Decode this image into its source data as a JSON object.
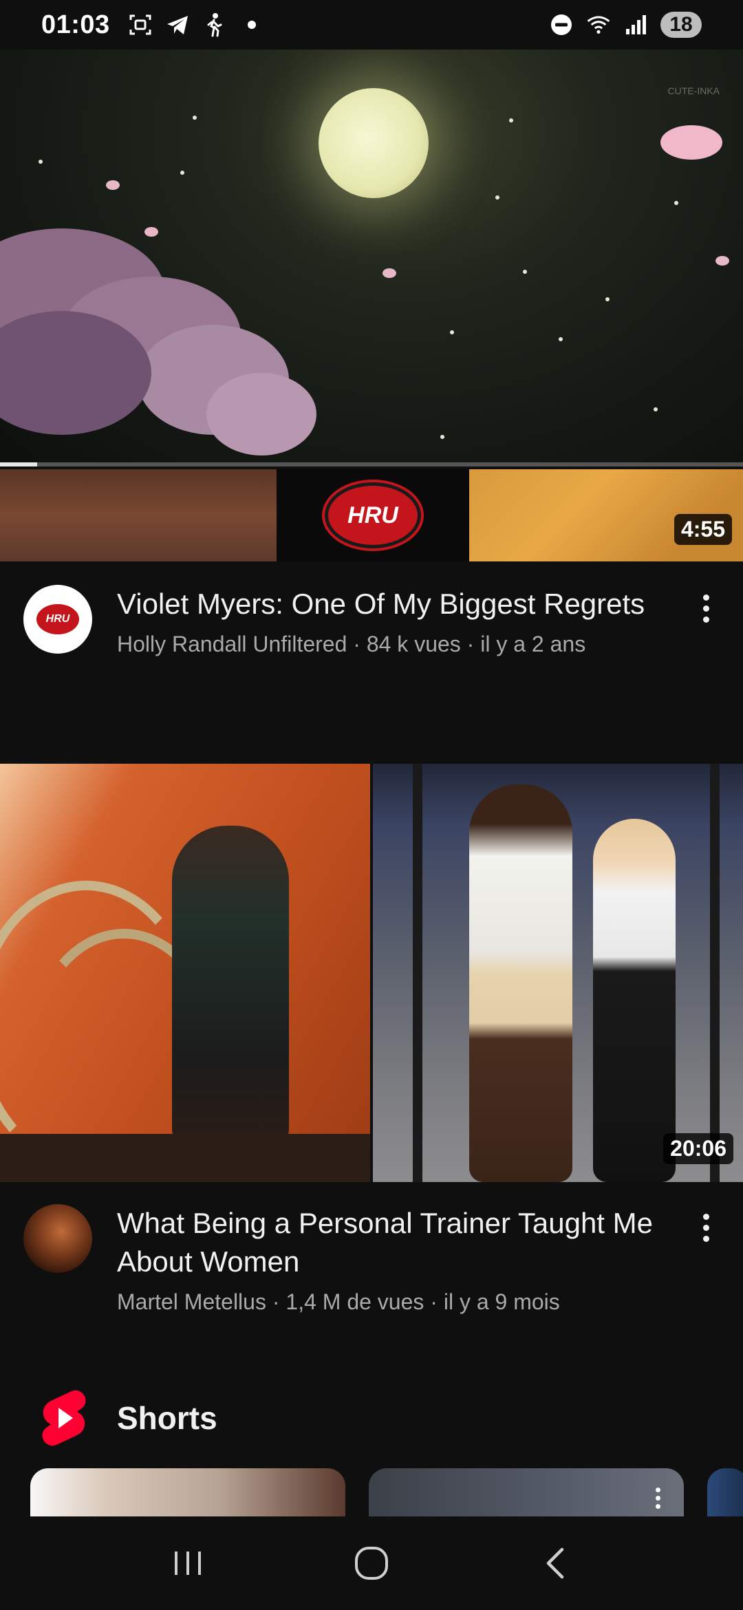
{
  "status_bar": {
    "time": "01:03",
    "left_icons": [
      "screenshot-icon",
      "telegram-icon",
      "walking-icon",
      "dot-icon"
    ],
    "right_icons": [
      "dnd-icon",
      "wifi-icon",
      "signal-icon"
    ],
    "battery": "18"
  },
  "mini_player": {
    "watermark": "CUTE-INKA",
    "progress": 0.05
  },
  "videos": [
    {
      "title": "Violet Myers: One Of My Biggest Regrets",
      "meta": "Holly Randall Unfiltered · 84 k vues · il y a 2 ans",
      "duration": "4:55",
      "logo_text": "HRU"
    },
    {
      "title": "What Being a Personal Trainer Taught Me About Women",
      "meta": "Martel Metellus · 1,4 M de vues · il y a 9 mois",
      "duration": "20:06"
    }
  ],
  "shorts": {
    "title": "Shorts"
  },
  "colors": {
    "background": "#0f0f0f",
    "text_primary": "#f1f1f1",
    "text_secondary": "#aaaaaa",
    "shorts_red": "#ff0033"
  },
  "nav": {
    "icons": [
      "recents-icon",
      "home-icon",
      "back-icon"
    ]
  }
}
